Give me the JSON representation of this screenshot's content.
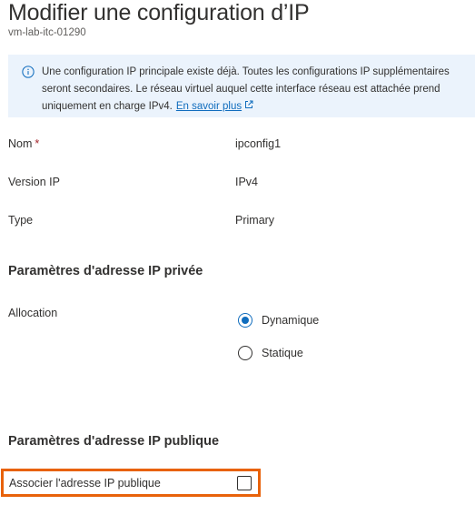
{
  "header": {
    "title": "Modifier une configuration d’IP",
    "subtitle": "vm-lab-itc-01290"
  },
  "info_banner": {
    "icon": "info-icon",
    "text": "Une configuration IP principale existe déjà. Toutes les configurations IP supplémentaires seront secondaires. Le réseau virtuel auquel cette interface réseau est attachée prend uniquement en charge IPv4.",
    "link_text": "En savoir plus",
    "link_icon": "external-link-icon",
    "bg_color": "#ebf3fc",
    "link_color": "#0f6cbd"
  },
  "fields": [
    {
      "label": "Nom",
      "required_mark": "*",
      "value": "ipconfig1"
    },
    {
      "label": "Version IP",
      "value": "IPv4"
    },
    {
      "label": "Type",
      "value": "Primary"
    }
  ],
  "private_ip": {
    "heading": "Paramètres d'adresse IP privée",
    "allocation_label": "Allocation",
    "options": [
      {
        "label": "Dynamique",
        "selected": true
      },
      {
        "label": "Statique",
        "selected": false
      }
    ]
  },
  "public_ip": {
    "heading": "Paramètres d'adresse IP publique",
    "associate_label": "Associer l'adresse IP publique",
    "associate_checked": false,
    "highlight_color": "#e8620a"
  }
}
